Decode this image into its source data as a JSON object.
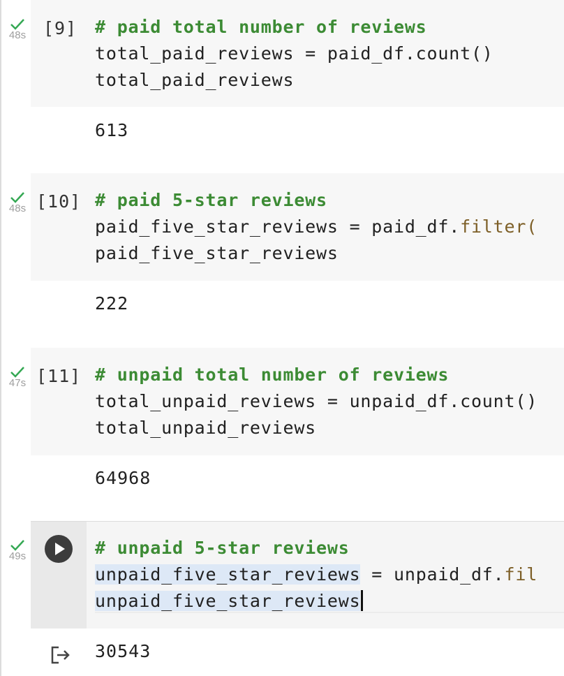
{
  "cells": [
    {
      "prompt": "[9]",
      "duration": "48s",
      "comment": "# paid total number of reviews",
      "line2": "total_paid_reviews = paid_df.count()",
      "line3": "total_paid_reviews",
      "output": "613"
    },
    {
      "prompt": "[10]",
      "duration": "48s",
      "comment": "# paid 5-star reviews",
      "line2_pre": "paid_five_star_reviews = paid_df.",
      "line2_fn": "filter(",
      "line3": "paid_five_star_reviews",
      "output": "222"
    },
    {
      "prompt": "[11]",
      "duration": "47s",
      "comment": "# unpaid total number of reviews",
      "line2": "total_unpaid_reviews = unpaid_df.count()",
      "line3": "total_unpaid_reviews",
      "output": "64968"
    },
    {
      "duration": "49s",
      "comment": "# unpaid 5-star reviews",
      "line2_sel": "unpaid_five_star_reviews",
      "line2_rest": " = unpaid_df.",
      "line2_fn": "fil",
      "line3": "unpaid_five_star_reviews",
      "output": "30543"
    }
  ],
  "colors": {
    "comment": "#3c8b34",
    "function": "#7d5f27",
    "check": "#34a853",
    "selection": "#dde8f6"
  },
  "icons": {
    "status": "check-icon",
    "run": "play-icon",
    "output": "output-arrow-icon"
  }
}
